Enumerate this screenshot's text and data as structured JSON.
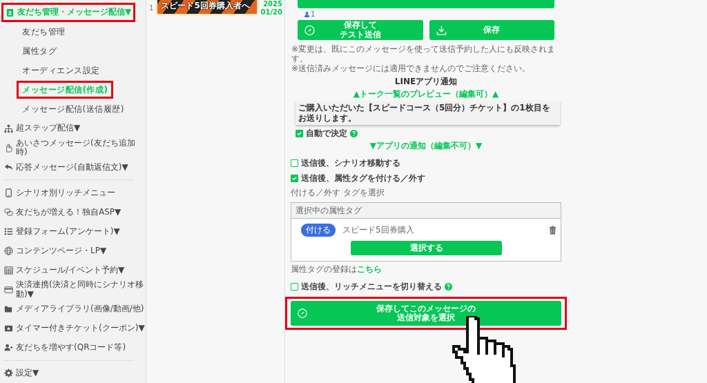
{
  "sidebar": {
    "sections": [
      [
        {
          "label": "友だち管理・メッセージ配信",
          "caret": "▼",
          "selected": true,
          "highlighted": true,
          "children": [
            {
              "label": "友だち管理",
              "selected": false,
              "highlighted": false
            },
            {
              "label": "属性タグ",
              "selected": false,
              "highlighted": false
            },
            {
              "label": "オーディエンス設定",
              "selected": false,
              "highlighted": false
            },
            {
              "label": "メッセージ配信(作成)",
              "selected": true,
              "highlighted": true
            },
            {
              "label": "メッセージ配信(送信履歴)",
              "selected": false,
              "highlighted": false
            }
          ]
        },
        {
          "label": "超ステップ配信",
          "caret": "▼",
          "selected": false,
          "highlighted": false
        },
        {
          "label": "あいさつメッセージ",
          "note": "(友だち追加時)",
          "selected": false,
          "highlighted": false
        },
        {
          "label": "応答メッセージ",
          "note": "(自動返信文)",
          "caret": "▼",
          "selected": false,
          "highlighted": false
        }
      ],
      [
        {
          "label": "シナリオ別リッチメニュー",
          "selected": false,
          "highlighted": false
        },
        {
          "label": "友だちが増える！独自ASP",
          "caret": "▼",
          "selected": false,
          "highlighted": false
        },
        {
          "label": "登録フォーム",
          "note": "(アンケート)",
          "caret": "▼",
          "selected": false,
          "highlighted": false
        },
        {
          "label": "コンテンツページ・LP",
          "caret": "▼",
          "selected": false,
          "highlighted": false
        },
        {
          "label": "スケジュール/イベント予約",
          "caret": "▼",
          "selected": false,
          "highlighted": false
        },
        {
          "label": "決済連携",
          "note": "(決済と同時にシナリオ移動)",
          "caret": "▼",
          "selected": false,
          "highlighted": false
        },
        {
          "label": "メディアライブラリ",
          "note": "(画像/動画/他)",
          "selected": false,
          "highlighted": false
        },
        {
          "label": "タイマー付きチケット",
          "note": "(クーポン)",
          "caret": "▼",
          "selected": false,
          "highlighted": false
        },
        {
          "label": "友だちを増やす",
          "note": "(QRコード等)",
          "selected": false,
          "highlighted": false
        }
      ],
      [
        {
          "label": "設定",
          "caret": "▼",
          "selected": false,
          "highlighted": false
        }
      ]
    ]
  },
  "message_list": {
    "rows": [
      {
        "index": "1",
        "title": "スピード5回券購入者へ",
        "date_lines": [
          "2025",
          "01/20"
        ]
      }
    ]
  },
  "editor": {
    "recipient_count": "1",
    "buttons": [
      {
        "kind": "test",
        "lines": [
          "保存して",
          "テスト送信"
        ]
      },
      {
        "kind": "save",
        "lines": [
          "保存"
        ]
      }
    ],
    "notes": [
      "※変更は、既にこのメッセージを使って送信予約した人にも反映されます。",
      "※送信済みメッセージには適用できませんのでご注意ください。"
    ],
    "notification": {
      "title": "LINEアプリ通知",
      "preview_heading": "▲トーク一覧のプレビュー（編集可）▲",
      "preview_text": "ご購入いただいた【スピードコース（5回分）チケット】の1枚目をお送りします。",
      "auto_decide": {
        "label": "自動で決定",
        "checked": true
      },
      "app_heading": "▼アプリの通知（編集不可）▼"
    },
    "scenario_option": {
      "label": "送信後、シナリオ移動する",
      "checked": false
    },
    "tag_option": {
      "label": "送信後、属性タグを付ける／外す",
      "checked": true
    },
    "tag_select": {
      "label": "付ける／外す タグを選択",
      "panel_title": "選択中の属性タグ",
      "tags": [
        {
          "action": "付ける",
          "name": "スピード5回券購入"
        }
      ],
      "select_button": "選択する",
      "register_text": "属性タグの登録は",
      "register_link": "こちら"
    },
    "richmenu_option": {
      "label": "送信後、リッチメニューを切り替える",
      "checked": false
    },
    "submit": {
      "lines": [
        "保存してこのメッセージの",
        "送信対象を選択"
      ],
      "highlighted": true
    }
  }
}
